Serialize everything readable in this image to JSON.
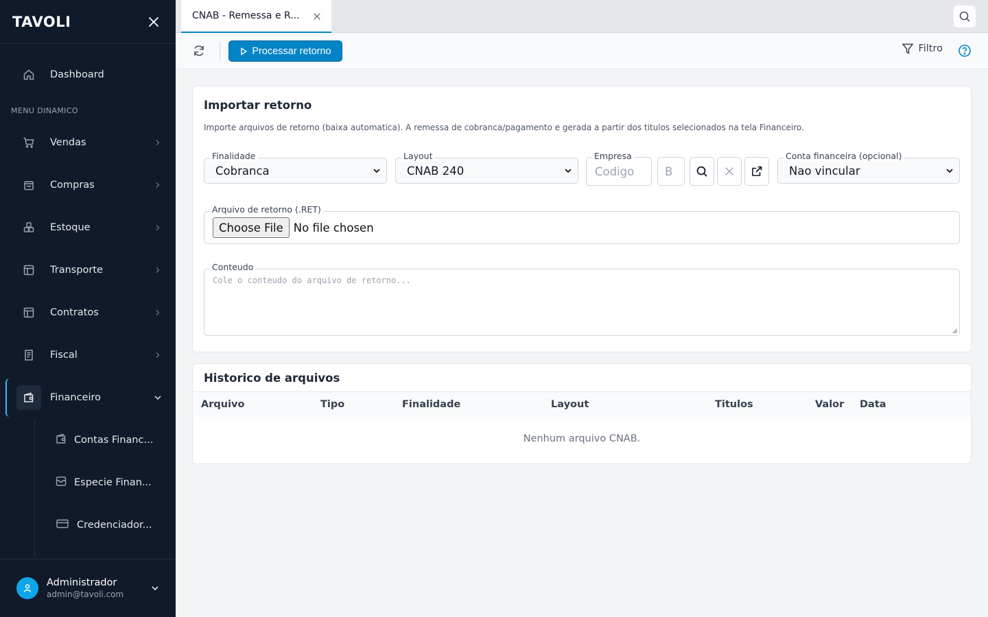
{
  "sidebar": {
    "brand": "TAVOLI",
    "section_label": "MENU DINAMICO",
    "dashboard": "Dashboard",
    "items": [
      {
        "label": "Vendas"
      },
      {
        "label": "Compras"
      },
      {
        "label": "Estoque"
      },
      {
        "label": "Transporte"
      },
      {
        "label": "Contratos"
      },
      {
        "label": "Fiscal"
      },
      {
        "label": "Financeiro"
      }
    ],
    "subitems": [
      {
        "label": "Contas Financ..."
      },
      {
        "label": "Especie Finan..."
      },
      {
        "label": "Credenciador..."
      }
    ],
    "user": {
      "name": "Administrador",
      "email": "admin@tavoli.com"
    }
  },
  "tabs": [
    {
      "label": "CNAB - Remessa e R...",
      "active": true
    }
  ],
  "toolbar": {
    "process_label": "Processar retorno",
    "filter_label": "Filtro"
  },
  "import": {
    "title": "Importar retorno",
    "description": "Importe arquivos de retorno (baixa automatica). A remessa de cobranca/pagamento e gerada a partir dos titulos selecionados na tela Financeiro.",
    "finalidade": {
      "label": "Finalidade",
      "value": "Cobranca"
    },
    "layout": {
      "label": "Layout",
      "value": "CNAB 240"
    },
    "empresa": {
      "label": "Empresa",
      "code_placeholder": "Codigo",
      "name_placeholder": "B"
    },
    "conta": {
      "label": "Conta financeira (opcional)",
      "value": "Nao vincular"
    },
    "arquivo": {
      "label": "Arquivo de retorno (.RET)",
      "button": "Choose File",
      "status": "No file chosen"
    },
    "conteudo": {
      "label": "Conteudo",
      "placeholder": "Cole o conteudo do arquivo de retorno..."
    }
  },
  "history": {
    "title": "Historico de arquivos",
    "columns": [
      "Arquivo",
      "Tipo",
      "Finalidade",
      "Layout",
      "Titulos",
      "Valor",
      "Data"
    ],
    "empty": "Nenhum arquivo CNAB."
  },
  "colors": {
    "sidebar": "#111a2b",
    "accent": "#0284c7",
    "active_indicator": "#38bdf8"
  }
}
